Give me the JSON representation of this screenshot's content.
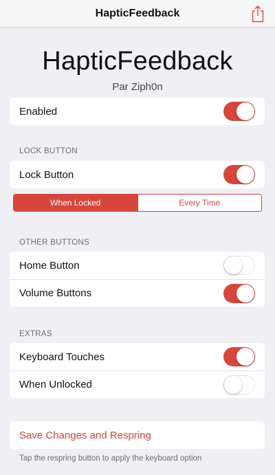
{
  "navbar": {
    "title": "HapticFeedback"
  },
  "header": {
    "title": "HapticFeedback",
    "subtitle": "Par Ziph0n"
  },
  "enabled": {
    "label": "Enabled",
    "on": true
  },
  "lock_section": {
    "header": "LOCK BUTTON",
    "lock_button": {
      "label": "Lock Button",
      "on": true
    },
    "segments": [
      "When Locked",
      "Every Time"
    ],
    "selected_segment": "When Locked"
  },
  "other_section": {
    "header": "OTHER BUTTONS",
    "items": [
      {
        "label": "Home Button",
        "on": false
      },
      {
        "label": "Volume Buttons",
        "on": true
      }
    ]
  },
  "extras_section": {
    "header": "EXTRAS",
    "items": [
      {
        "label": "Keyboard Touches",
        "on": true
      },
      {
        "label": "When Unlocked",
        "on": false
      }
    ]
  },
  "respring": {
    "label": "Save Changes and Respring",
    "footer": "Tap the respring button to apply the keyboard option"
  },
  "colors": {
    "accent": "#d6463c",
    "background": "#efeff4"
  }
}
